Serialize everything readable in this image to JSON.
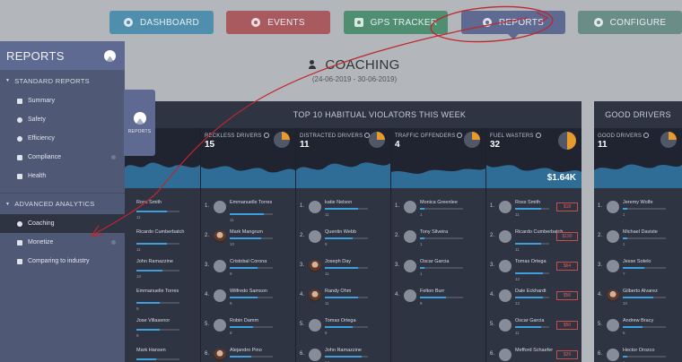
{
  "nav": [
    {
      "label": "DASHBOARD",
      "icon": "dashboard-icon"
    },
    {
      "label": "EVENTS",
      "icon": "events-icon"
    },
    {
      "label": "GPS TRACKER",
      "icon": "map-pin-icon"
    },
    {
      "label": "REPORTS",
      "icon": "pie-chart-icon"
    },
    {
      "label": "CONFIGURE",
      "icon": "configure-icon"
    }
  ],
  "page": {
    "title": "COACHING",
    "date_range": "(24-06-2019 - 30-06-2019)"
  },
  "sidebar": {
    "title": "REPORTS",
    "float_label": "REPORTS",
    "standard_header": "STANDARD REPORTS",
    "standard_items": [
      "Summary",
      "Safety",
      "Efficiency",
      "Compliance",
      "Health"
    ],
    "advanced_header": "ADVANCED ANALYTICS",
    "advanced_items": [
      "Coaching",
      "Monetize",
      "Comparing to industry"
    ]
  },
  "violators": {
    "title": "TOP 10 HABITUAL VIOLATORS THIS WEEK",
    "columns": [
      {
        "label": "",
        "count": "",
        "rows": [
          {
            "rank": "",
            "name": "Ross Smith",
            "score": "11"
          },
          {
            "rank": "",
            "name": "Ricardo Cumberbatch",
            "score": "11"
          },
          {
            "rank": "",
            "name": "John Ramazzine",
            "score": "10"
          },
          {
            "rank": "",
            "name": "Emmanuelle Torres",
            "score": "9"
          },
          {
            "rank": "",
            "name": "Jose Villasenor",
            "score": "9"
          },
          {
            "rank": "",
            "name": "Mark Hansen",
            "score": ""
          }
        ]
      },
      {
        "label": "RECKLESS DRIVERS",
        "count": "15",
        "rows": [
          {
            "rank": "1.",
            "name": "Emmanuelle Torres",
            "score": "11"
          },
          {
            "rank": "2.",
            "name": "Mark Mangrum",
            "score": "10"
          },
          {
            "rank": "3.",
            "name": "Cristobal Corona",
            "score": "9"
          },
          {
            "rank": "4.",
            "name": "Wilfredo Samson",
            "score": "9"
          },
          {
            "rank": "5.",
            "name": "Robin Damm",
            "score": "8"
          },
          {
            "rank": "6.",
            "name": "Alejandro Pino",
            "score": ""
          }
        ]
      },
      {
        "label": "DISTRACTED DRIVERS",
        "count": "11",
        "rows": [
          {
            "rank": "1.",
            "name": "katie Nelson",
            "score": "11"
          },
          {
            "rank": "2.",
            "name": "Quentin Webb",
            "score": "9"
          },
          {
            "rank": "3.",
            "name": "Joseph Day",
            "score": "11"
          },
          {
            "rank": "4.",
            "name": "Randy Ohm",
            "score": "11"
          },
          {
            "rank": "5.",
            "name": "Tomas Ortega",
            "score": "9"
          },
          {
            "rank": "6.",
            "name": "John Ramazzine",
            "score": "12"
          }
        ]
      },
      {
        "label": "TRAFFIC OFFENDERS",
        "count": "4",
        "rows": [
          {
            "rank": "1.",
            "name": "Monica Greenlee",
            "score": "1"
          },
          {
            "rank": "2.",
            "name": "Tony Silveira",
            "score": "1"
          },
          {
            "rank": "3.",
            "name": "Oscar Garcia",
            "score": "1"
          },
          {
            "rank": "4.",
            "name": "Felton Burr",
            "score": "8"
          }
        ]
      },
      {
        "label": "FUEL WASTERS",
        "count": "32",
        "total": "$1.64K",
        "rows": [
          {
            "rank": "1.",
            "name": "Ross Smith",
            "score": "11",
            "cost": "$18"
          },
          {
            "rank": "2.",
            "name": "Ricardo Cumberbatch",
            "score": "11",
            "cost": "$190"
          },
          {
            "rank": "3.",
            "name": "Tomas Ortega",
            "score": "12",
            "cost": "$64"
          },
          {
            "rank": "4.",
            "name": "Dale Eckhardt",
            "score": "12",
            "cost": "$56"
          },
          {
            "rank": "5.",
            "name": "Oscar Garcia",
            "score": "11",
            "cost": "$50"
          },
          {
            "rank": "6.",
            "name": "Mefford Schaefer",
            "score": "",
            "cost": "$29"
          }
        ]
      }
    ]
  },
  "good": {
    "title": "GOOD DRIVERS",
    "label": "GOOD DRIVERS",
    "count": "11",
    "rows": [
      {
        "rank": "1.",
        "name": "Jeremy Wolfe",
        "score": "1"
      },
      {
        "rank": "2.",
        "name": "Michael Daviste",
        "score": "1"
      },
      {
        "rank": "3.",
        "name": "Jesse Sotelo",
        "score": "7"
      },
      {
        "rank": "4.",
        "name": "Gilberto Alvarez",
        "score": "10"
      },
      {
        "rank": "5.",
        "name": "Andrew Bracy",
        "score": "6"
      },
      {
        "rank": "6.",
        "name": "Hector Orozco",
        "score": "1"
      }
    ]
  },
  "colors": {
    "accent": "#5e6a92",
    "annotation": "#c0262d",
    "cost": "#c84d4d",
    "bar": "#3aa0de"
  }
}
